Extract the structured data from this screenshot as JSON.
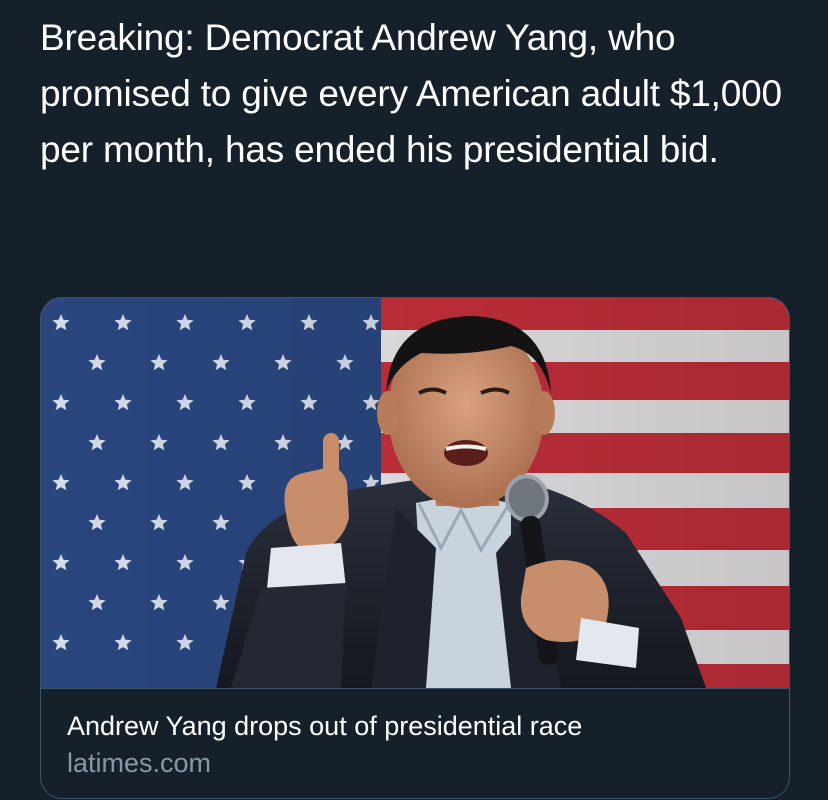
{
  "tweet": {
    "text": "Breaking: Democrat Andrew Yang, who promised to give every American adult $1,000 per month, has ended his presidential bid."
  },
  "link_card": {
    "title": "Andrew Yang drops out of presidential race",
    "domain": "latimes.com"
  },
  "colors": {
    "background": "#15202b",
    "card_border": "#3d5466",
    "text_primary": "#ffffff",
    "text_secondary": "#8899a6"
  }
}
